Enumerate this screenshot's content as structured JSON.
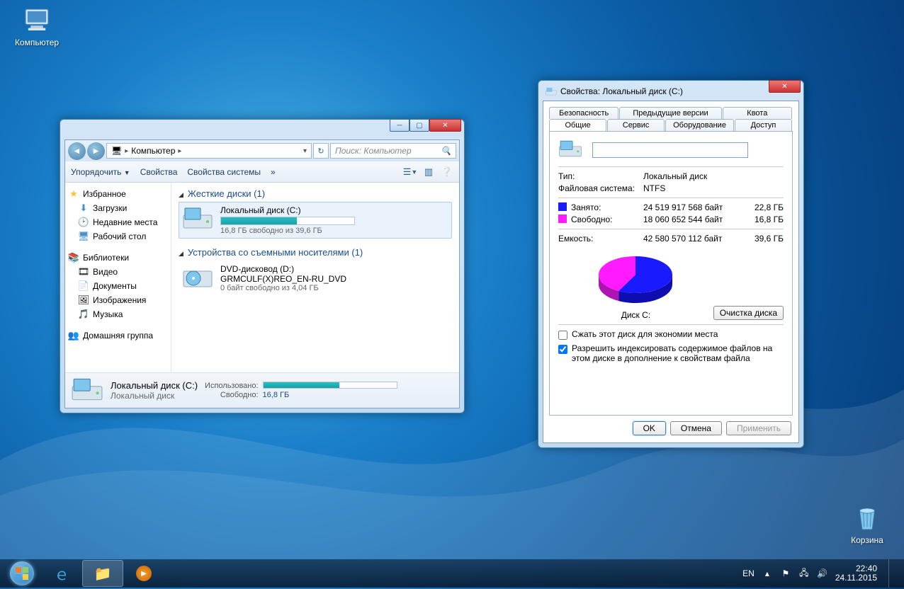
{
  "desktop": {
    "computer_label": "Компьютер",
    "trash_label": "Корзина"
  },
  "explorer": {
    "breadcrumb_root": "Компьютер",
    "search_placeholder": "Поиск: Компьютер",
    "toolbar": {
      "organize": "Упорядочить",
      "properties": "Свойства",
      "sysprops": "Свойства системы",
      "overflow": "»"
    },
    "sidebar": {
      "favorites": "Избранное",
      "downloads": "Загрузки",
      "recent": "Недавние места",
      "desktop": "Рабочий стол",
      "libraries": "Библиотеки",
      "video": "Видео",
      "documents": "Документы",
      "pictures": "Изображения",
      "music": "Музыка",
      "homegroup": "Домашняя группа"
    },
    "sections": {
      "hdd_header": "Жесткие диски (1)",
      "removable_header": "Устройства со съемными носителями (1)"
    },
    "drives": {
      "c_name": "Локальный диск (C:)",
      "c_free": "16,8 ГБ свободно из 39,6 ГБ",
      "c_fill_percent": 57,
      "d_name": "DVD-дисковод (D:)",
      "d_vol": "GRMCULF(X)REO_EN-RU_DVD",
      "d_free": "0 байт свободно из 4,04 ГБ"
    },
    "details": {
      "title": "Локальный диск (C:)",
      "type": "Локальный диск",
      "used_label": "Использовано:",
      "free_label": "Свободно:",
      "free_val": "16,8 ГБ",
      "bar_fill_percent": 57
    }
  },
  "props": {
    "title": "Свойства: Локальный диск (C:)",
    "tabs_row1": {
      "security": "Безопасность",
      "prev": "Предыдущие версии",
      "quota": "Квота"
    },
    "tabs_row2": {
      "general": "Общие",
      "service": "Сервис",
      "hardware": "Оборудование",
      "access": "Доступ"
    },
    "type_label": "Тип:",
    "type_val": "Локальный диск",
    "fs_label": "Файловая система:",
    "fs_val": "NTFS",
    "used_label": "Занято:",
    "used_bytes": "24 519 917 568 байт",
    "used_gb": "22,8 ГБ",
    "free_label": "Свободно:",
    "free_bytes": "18 060 652 544 байт",
    "free_gb": "16,8 ГБ",
    "cap_label": "Емкость:",
    "cap_bytes": "42 580 570 112 байт",
    "cap_gb": "39,6 ГБ",
    "pie_label": "Диск C:",
    "cleanup": "Очистка диска",
    "compress": "Сжать этот диск для экономии места",
    "index": "Разрешить индексировать содержимое файлов на этом диске в дополнение к свойствам файла",
    "ok": "OK",
    "cancel": "Отмена",
    "apply": "Применить",
    "volume_name": ""
  },
  "taskbar": {
    "lang": "EN",
    "time": "22:40",
    "date": "24.11.2015"
  },
  "chart_data": {
    "type": "pie",
    "title": "Диск C:",
    "series": [
      {
        "name": "Занято",
        "value": 24519917568,
        "color": "#1a1aff",
        "label": "22,8 ГБ"
      },
      {
        "name": "Свободно",
        "value": 18060652544,
        "color": "#ff1aff",
        "label": "16,8 ГБ"
      }
    ],
    "total": 42580570112
  }
}
